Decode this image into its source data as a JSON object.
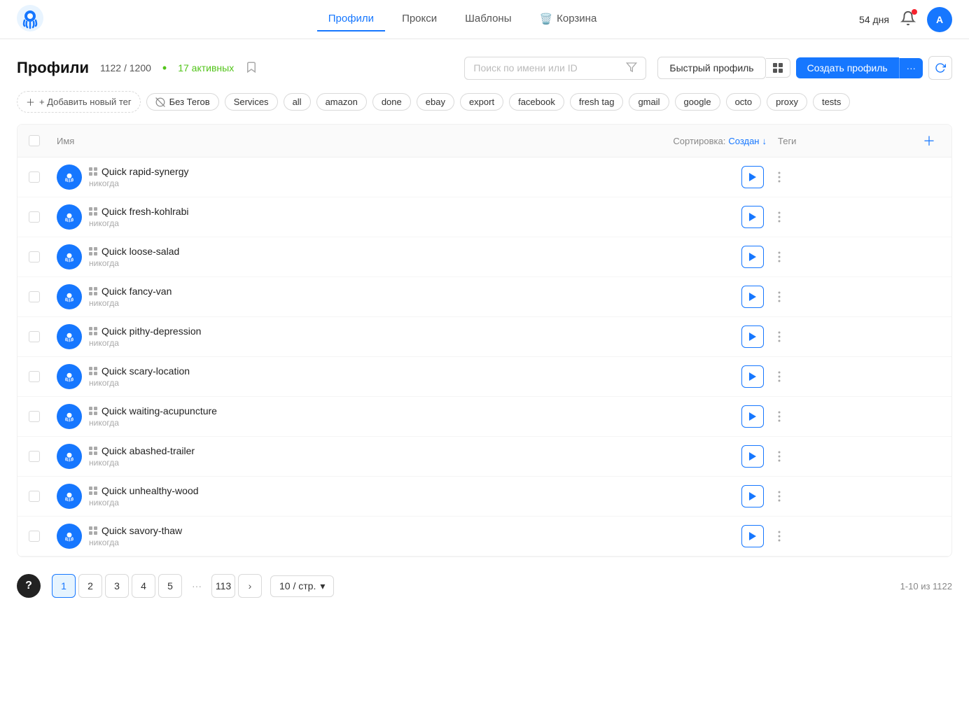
{
  "header": {
    "nav": [
      {
        "label": "Профили",
        "id": "profiles",
        "active": true
      },
      {
        "label": "Прокси",
        "id": "proxy",
        "active": false
      },
      {
        "label": "Шаблоны",
        "id": "templates",
        "active": false
      },
      {
        "label": "Корзина",
        "id": "basket",
        "active": false,
        "icon": true
      }
    ],
    "days": "54 дня",
    "avatar_initial": "A"
  },
  "page": {
    "title": "Профили",
    "count": "1122 / 1200",
    "active_label": "17 активных",
    "search_placeholder": "Поиск по имени или ID",
    "btn_quick": "Быстрый профиль",
    "btn_create": "Создать профиль",
    "sort_label": "Сортировка:",
    "sort_field": "Создан",
    "col_name": "Имя",
    "col_tags": "Теги"
  },
  "tags": [
    {
      "label": "+ Добавить новый тег",
      "id": "add-tag",
      "add": true
    },
    {
      "label": "Без Тегов",
      "id": "no-tag",
      "no_tag_icon": true
    },
    {
      "label": "Services",
      "id": "services"
    },
    {
      "label": "all",
      "id": "all"
    },
    {
      "label": "amazon",
      "id": "amazon"
    },
    {
      "label": "done",
      "id": "done"
    },
    {
      "label": "ebay",
      "id": "ebay"
    },
    {
      "label": "export",
      "id": "export"
    },
    {
      "label": "facebook",
      "id": "facebook"
    },
    {
      "label": "fresh tag",
      "id": "fresh-tag"
    },
    {
      "label": "gmail",
      "id": "gmail"
    },
    {
      "label": "google",
      "id": "google"
    },
    {
      "label": "octo",
      "id": "octo"
    },
    {
      "label": "proxy",
      "id": "proxy"
    },
    {
      "label": "tests",
      "id": "tests"
    }
  ],
  "profiles": [
    {
      "name": "Quick rapid-synergy",
      "sub": "никогда",
      "id": "p1"
    },
    {
      "name": "Quick fresh-kohlrabi",
      "sub": "никогда",
      "id": "p2"
    },
    {
      "name": "Quick loose-salad",
      "sub": "никогда",
      "id": "p3"
    },
    {
      "name": "Quick fancy-van",
      "sub": "никогда",
      "id": "p4"
    },
    {
      "name": "Quick pithy-depression",
      "sub": "никогда",
      "id": "p5"
    },
    {
      "name": "Quick scary-location",
      "sub": "никогда",
      "id": "p6"
    },
    {
      "name": "Quick waiting-acupuncture",
      "sub": "никогда",
      "id": "p7"
    },
    {
      "name": "Quick abashed-trailer",
      "sub": "никогда",
      "id": "p8"
    },
    {
      "name": "Quick unhealthy-wood",
      "sub": "никогда",
      "id": "p9"
    },
    {
      "name": "Quick savory-thaw",
      "sub": "никогда",
      "id": "p10"
    }
  ],
  "pagination": {
    "pages": [
      "1",
      "2",
      "3",
      "4",
      "5",
      "···",
      "113"
    ],
    "current": "1",
    "per_page": "10 / стр.",
    "total": "1-10 из 1122"
  },
  "footer": {
    "help_label": "?"
  }
}
